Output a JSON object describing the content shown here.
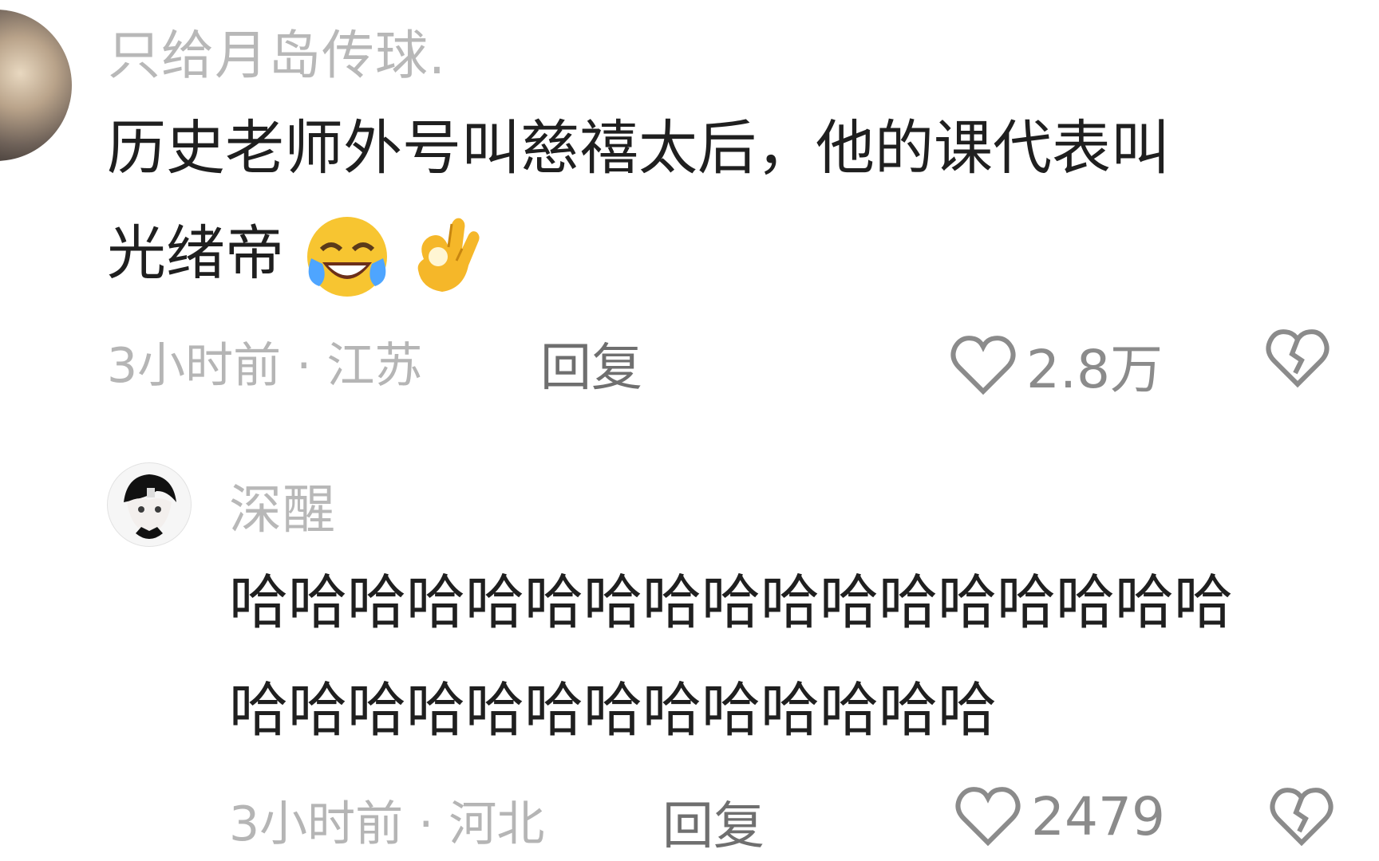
{
  "comment": {
    "username": "只给月岛传球.",
    "text_line1": "历史老师外号叫慈禧太后，他的课代表叫",
    "text_line2": "光绪帝",
    "time_location": "3小时前 · 江苏",
    "reply_label": "回复",
    "likes": "2.8万",
    "emoji_1": "laughing-crying-icon",
    "emoji_2": "ok-hand-icon"
  },
  "reply_comment": {
    "username": "深醒",
    "text_line1": "哈哈哈哈哈哈哈哈哈哈哈哈哈哈哈哈哈",
    "text_line2": "哈哈哈哈哈哈哈哈哈哈哈哈哈",
    "time_location": "3小时前 · 河北",
    "reply_label": "回复",
    "likes": "2479"
  },
  "colors": {
    "username": "#b8b8b8",
    "content": "#1f1f1f",
    "meta": "#b5b5b5",
    "reply": "#6f6f6f",
    "like": "#8b8b8b"
  }
}
